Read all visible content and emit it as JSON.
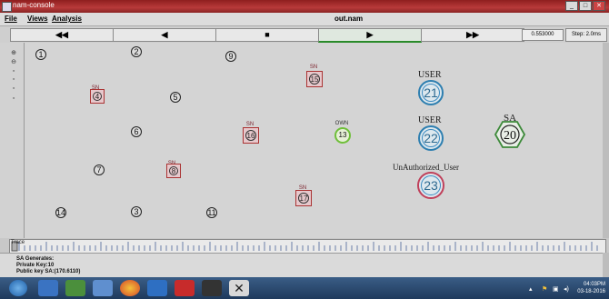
{
  "window": {
    "title": "nam-console",
    "file_title": "out.nam"
  },
  "menu": {
    "file": "File",
    "views": "Views",
    "analysis": "Analysis"
  },
  "controls": {
    "rewind": "◀◀",
    "back": "◀",
    "stop": "■",
    "play": "▶",
    "ffwd": "▶▶",
    "time": "0.553000",
    "step": "Step: 2.0ms"
  },
  "nodes": {
    "n1": "1",
    "n2": "2",
    "n3": "3",
    "n4": "4",
    "n5": "5",
    "n6": "6",
    "n7": "7",
    "n8": "8",
    "n9": "9",
    "n10": "10",
    "n11": "11",
    "n12": "12",
    "n13": "13",
    "n14": "14",
    "n15": "15",
    "n16": "16",
    "n17": "17",
    "n21": "21",
    "n22": "22",
    "n20": "20",
    "n23": "23"
  },
  "labels": {
    "sn": "SN",
    "own": "OWN",
    "user": "USER",
    "sa": "SA",
    "unauth": "UnAuthorized_User"
  },
  "timeline": {
    "label": "Trace"
  },
  "info": {
    "line1": "SA Generates:",
    "line2": "Private Key:10",
    "line3": "Public key SA:(170.6110)"
  },
  "taskbar": {
    "time": "04:03PM",
    "date": "03-18-2016"
  },
  "colors": {
    "accent_green": "#2a8a2a",
    "sn_red": "#a33",
    "user_blue": "#2e7fb0"
  }
}
